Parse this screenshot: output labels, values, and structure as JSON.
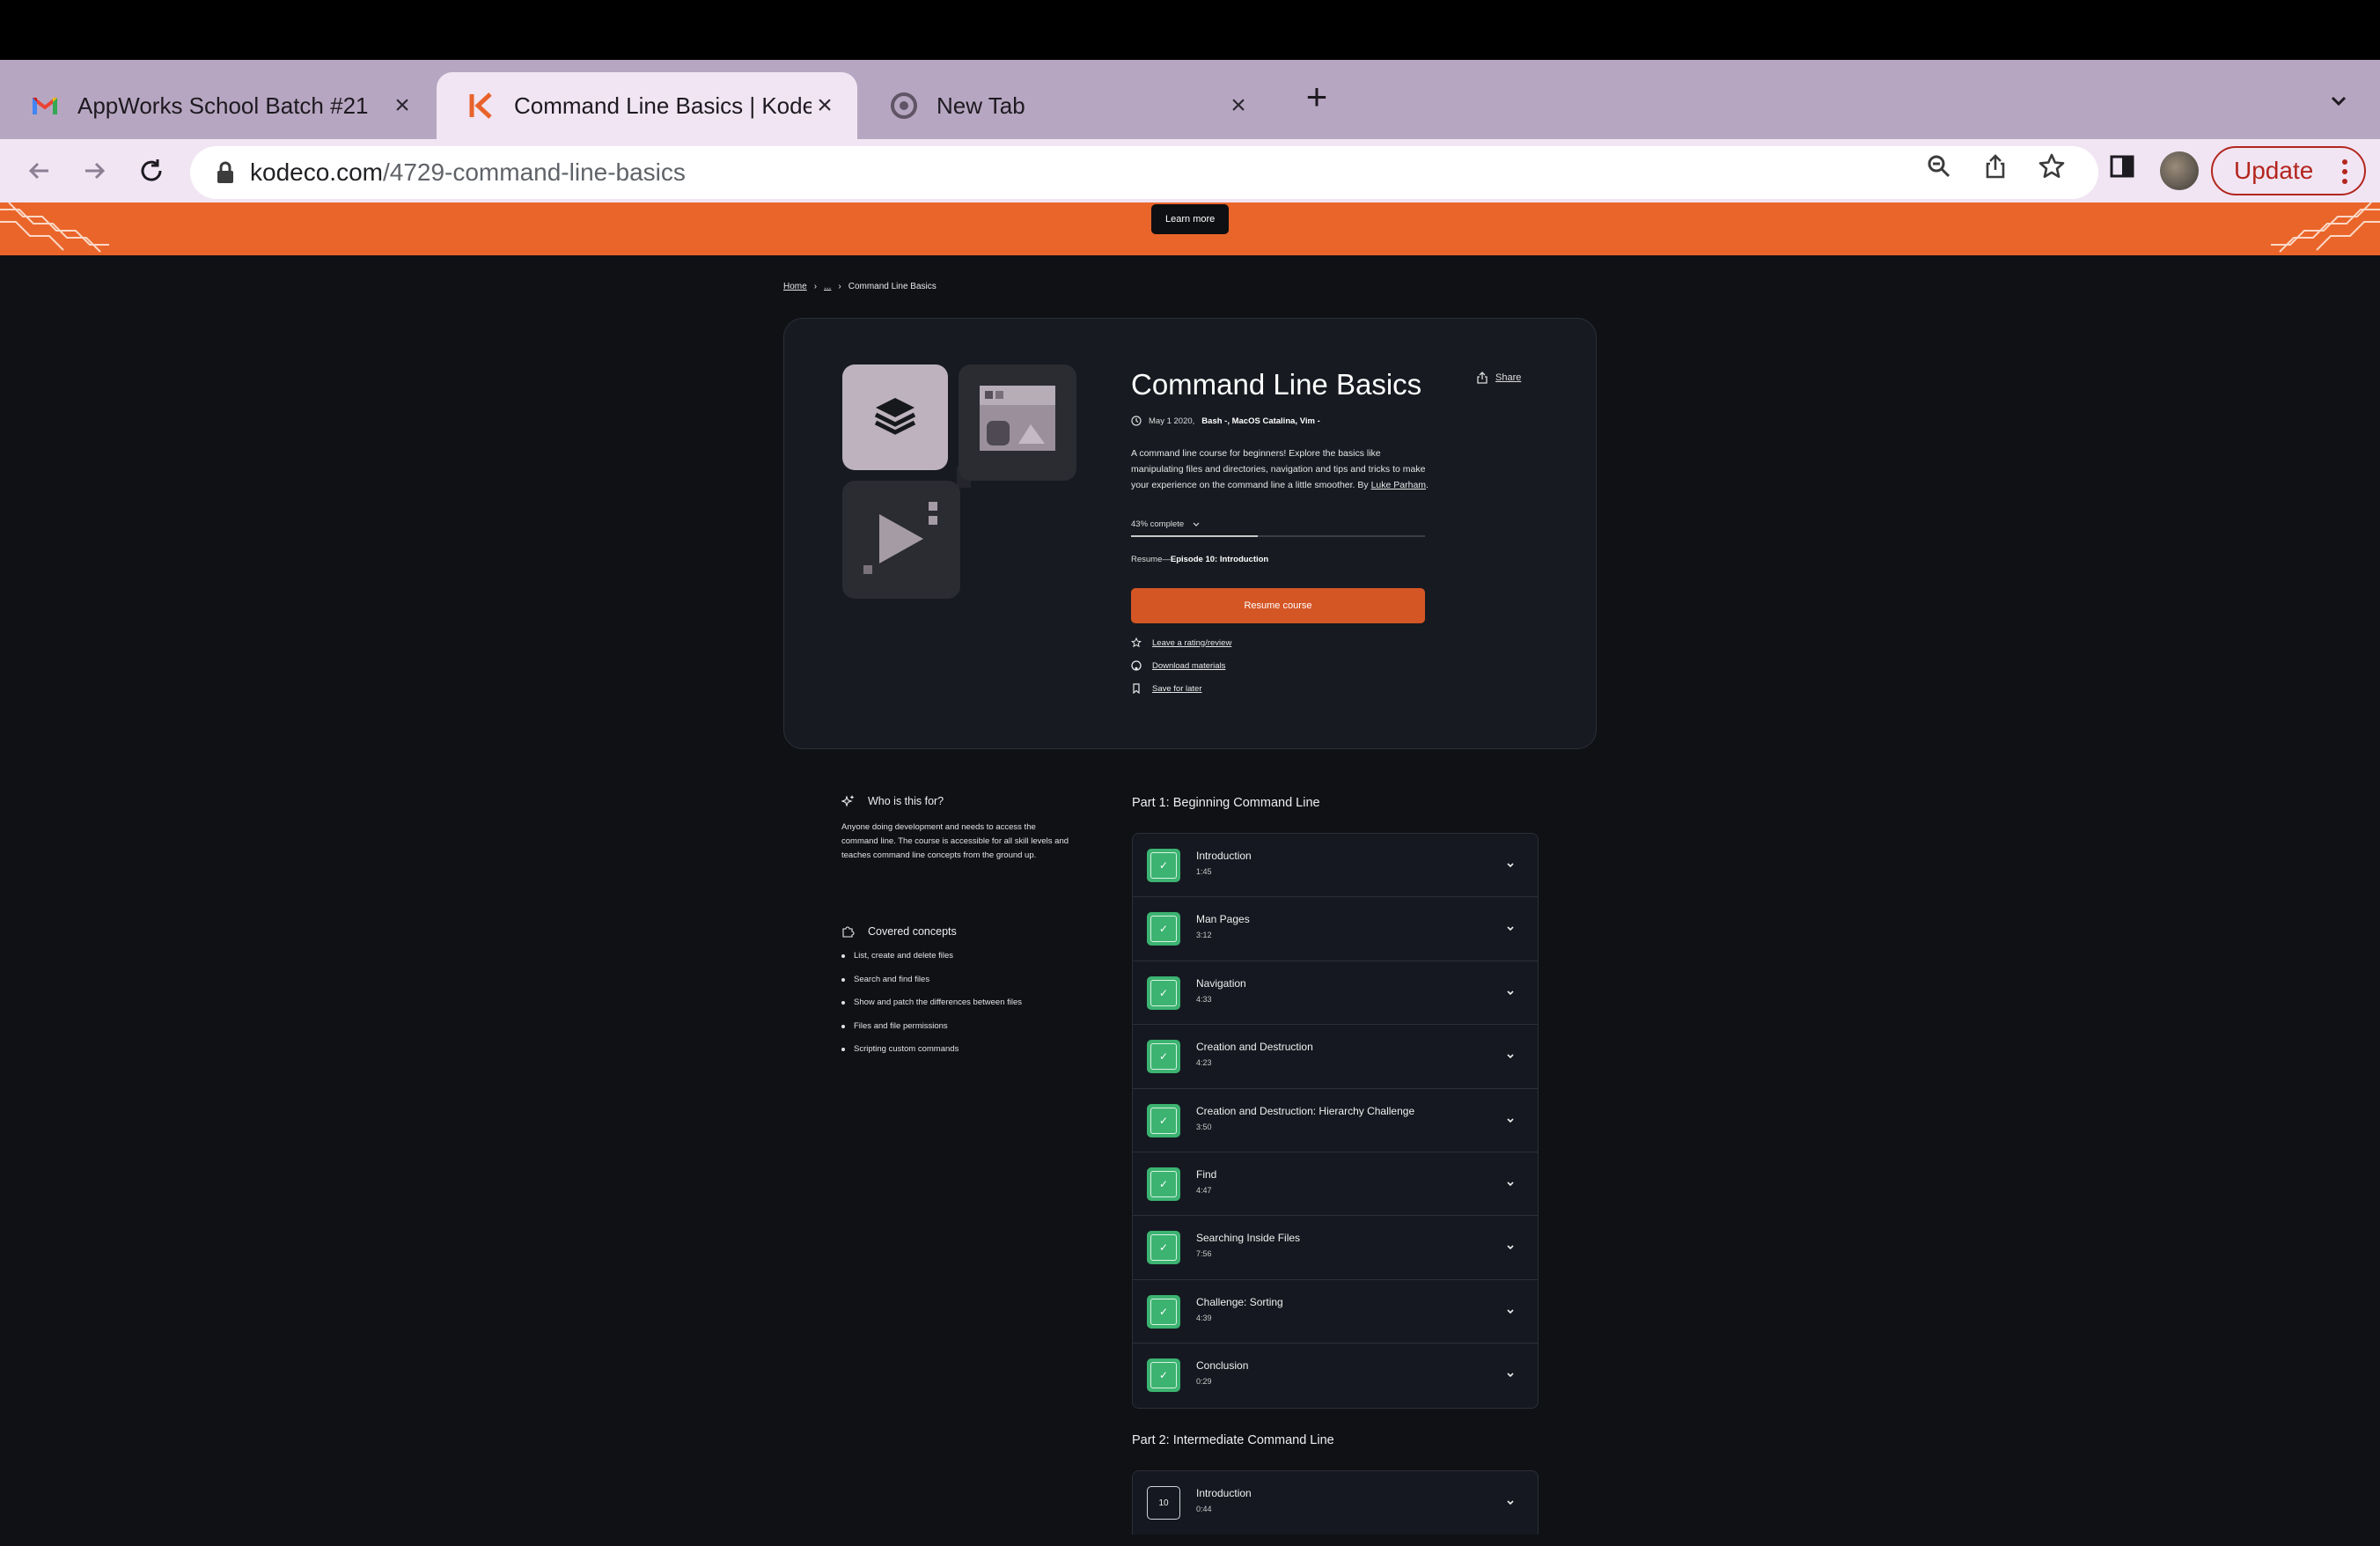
{
  "browser": {
    "tabs": [
      {
        "title": "AppWorks School Batch #21",
        "icon": "gmail-icon"
      },
      {
        "title": "Command Line Basics | Kodeco",
        "icon": "kodeco-icon"
      },
      {
        "title": "New Tab",
        "icon": "chrome-icon"
      }
    ],
    "url_domain": "kodeco.com",
    "url_path": "/4729-command-line-basics",
    "update_label": "Update"
  },
  "banner": {
    "learn_more": "Learn more"
  },
  "breadcrumb": {
    "home": "Home",
    "ellipsis": "...",
    "current": "Command Line Basics"
  },
  "course": {
    "title": "Command Line Basics",
    "share_label": "Share",
    "date": "May 1 2020,",
    "tech": "Bash -, MacOS Catalina, Vim -",
    "description": "A command line course for beginners! Explore the basics like manipulating files and directories, navigation and tips and tricks to make your experience on the command line a little smoother. By",
    "author": "Luke Parham",
    "author_suffix": ".",
    "progress_label": "43% complete",
    "progress_value": 0.43,
    "resume_prefix": "Resume—",
    "resume_episode": "Episode 10: Introduction",
    "resume_button": "Resume course",
    "actions": {
      "rate": "Leave a rating/review",
      "download": "Download materials",
      "save": "Save for later"
    }
  },
  "sidebar": {
    "who_title": "Who is this for?",
    "who_text": "Anyone doing development and needs to access the command line. The course is accessible for all skill levels and teaches command line concepts from the ground up.",
    "concepts_title": "Covered concepts",
    "concepts": [
      "List, create and delete files",
      "Search and find files",
      "Show and patch the differences between files",
      "Files and file permissions",
      "Scripting custom commands"
    ]
  },
  "parts": [
    {
      "title": "Part 1: Beginning Command Line",
      "episodes": [
        {
          "title": "Introduction",
          "duration": "1:45",
          "completed": true
        },
        {
          "title": "Man Pages",
          "duration": "3:12",
          "completed": true
        },
        {
          "title": "Navigation",
          "duration": "4:33",
          "completed": true
        },
        {
          "title": "Creation and Destruction",
          "duration": "4:23",
          "completed": true
        },
        {
          "title": "Creation and Destruction: Hierarchy Challenge",
          "duration": "3:50",
          "completed": true
        },
        {
          "title": "Find",
          "duration": "4:47",
          "completed": true
        },
        {
          "title": "Searching Inside Files",
          "duration": "7:56",
          "completed": true
        },
        {
          "title": "Challenge: Sorting",
          "duration": "4:39",
          "completed": true
        },
        {
          "title": "Conclusion",
          "duration": "0:29",
          "completed": true
        }
      ]
    },
    {
      "title": "Part 2: Intermediate Command Line",
      "episodes": [
        {
          "title": "Introduction",
          "duration": "0:44",
          "completed": false,
          "number": "10"
        }
      ]
    }
  ],
  "colors": {
    "accent": "#d45625",
    "banner": "#ea652a",
    "complete": "#3cb371",
    "page_bg": "#0f1115"
  }
}
